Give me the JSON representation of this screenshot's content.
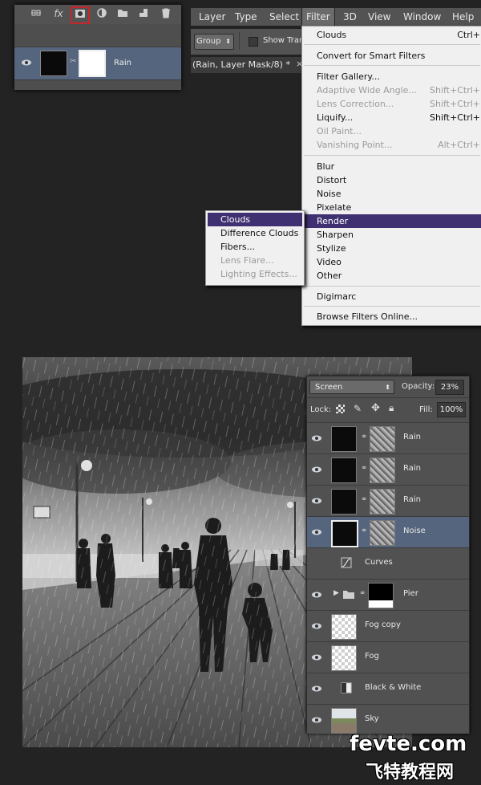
{
  "strip": {
    "icons": [
      "link-icon",
      "fx-icon",
      "add-mask-icon",
      "adjustment-icon",
      "folder-icon",
      "new-layer-icon",
      "trash-icon"
    ],
    "fx_label": "fx",
    "layer_name": "Rain"
  },
  "menubar": {
    "items": [
      "Layer",
      "Type",
      "Select",
      "Filter",
      "3D",
      "View",
      "Window",
      "Help"
    ]
  },
  "options": {
    "group_label": "Group",
    "show_transform": "Show Trans"
  },
  "doc_tab": "(Rain, Layer Mask/8) *",
  "doc_tab_close": "×",
  "filter_menu": {
    "items": [
      {
        "label": "Clouds",
        "shortcut": "Ctrl+"
      },
      {
        "label": "Convert for Smart Filters",
        "shortcut": ""
      },
      {
        "label": "Filter Gallery...",
        "shortcut": ""
      },
      {
        "label": "Adaptive Wide Angle...",
        "shortcut": "Shift+Ctrl+"
      },
      {
        "label": "Lens Correction...",
        "shortcut": "Shift+Ctrl+"
      },
      {
        "label": "Liquify...",
        "shortcut": "Shift+Ctrl+"
      },
      {
        "label": "Oil Paint...",
        "shortcut": ""
      },
      {
        "label": "Vanishing Point...",
        "shortcut": "Alt+Ctrl+"
      },
      {
        "label": "Blur",
        "shortcut": ""
      },
      {
        "label": "Distort",
        "shortcut": ""
      },
      {
        "label": "Noise",
        "shortcut": ""
      },
      {
        "label": "Pixelate",
        "shortcut": ""
      },
      {
        "label": "Render",
        "shortcut": ""
      },
      {
        "label": "Sharpen",
        "shortcut": ""
      },
      {
        "label": "Stylize",
        "shortcut": ""
      },
      {
        "label": "Video",
        "shortcut": ""
      },
      {
        "label": "Other",
        "shortcut": ""
      },
      {
        "label": "Digimarc",
        "shortcut": ""
      },
      {
        "label": "Browse Filters Online...",
        "shortcut": ""
      }
    ]
  },
  "render_submenu": {
    "items": [
      "Clouds",
      "Difference Clouds",
      "Fibers...",
      "Lens Flare...",
      "Lighting Effects..."
    ]
  },
  "layers_panel": {
    "blend_mode": "Screen",
    "opacity_label": "Opacity:",
    "opacity_value": "23%",
    "lock_label": "Lock:",
    "fill_label": "Fill:",
    "fill_value": "100%",
    "layers": [
      {
        "name": "Rain"
      },
      {
        "name": "Rain"
      },
      {
        "name": "Rain"
      },
      {
        "name": "Noise"
      },
      {
        "name": "Curves"
      },
      {
        "name": "Pier"
      },
      {
        "name": "Fog copy"
      },
      {
        "name": "Fog"
      },
      {
        "name": "Black & White"
      },
      {
        "name": "Sky"
      }
    ]
  },
  "watermark": {
    "line1": "fevte.com",
    "line2": "飞特教程网"
  },
  "colors": {
    "menu_highlight": "#3f3171",
    "active_layer": "#55657d",
    "panel_bg": "#4f4f4f",
    "mask_highlight_border": "#c8252b"
  }
}
